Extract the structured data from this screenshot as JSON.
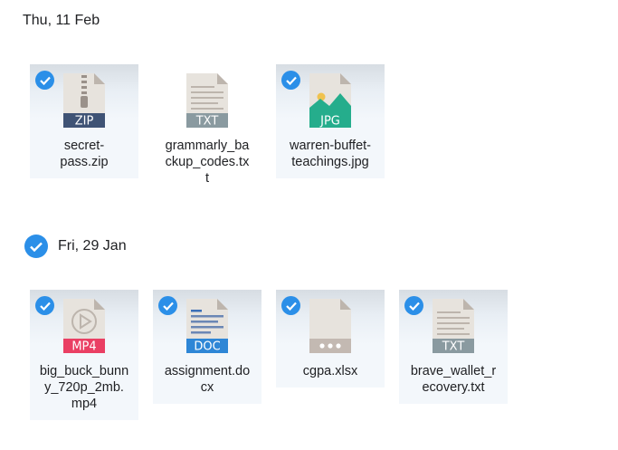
{
  "groups": [
    {
      "date": "Thu, 11 Feb",
      "group_selected": false,
      "files": [
        {
          "name": "secret-\npass.zip",
          "type": "ZIP",
          "selected": true,
          "icon": "zip-file-icon"
        },
        {
          "name": "grammarly_ba\nckup_codes.tx\nt",
          "type": "TXT",
          "selected": false,
          "icon": "txt-file-icon"
        },
        {
          "name": "warren-buffet-\nteachings.jpg",
          "type": "JPG",
          "selected": true,
          "icon": "image-file-icon"
        }
      ]
    },
    {
      "date": "Fri, 29 Jan",
      "group_selected": true,
      "files": [
        {
          "name": "big_buck_bunn\ny_720p_2mb.\nmp4",
          "type": "MP4",
          "selected": true,
          "icon": "video-file-icon"
        },
        {
          "name": "assignment.do\ncx",
          "type": "DOC",
          "selected": true,
          "icon": "doc-file-icon"
        },
        {
          "name": "cgpa.xlsx",
          "type": "",
          "selected": true,
          "icon": "generic-file-icon"
        },
        {
          "name": "brave_wallet_r\necovery.txt",
          "type": "TXT",
          "selected": true,
          "icon": "txt-file-icon"
        }
      ]
    }
  ],
  "colors": {
    "accent": "#2b8fe8",
    "zip_band": "#3f5375",
    "txt_band": "#8a9aa0",
    "jpg_band": "#25ad8c",
    "mp4_band": "#ea3f63",
    "doc_band": "#2e86d6",
    "generic_band": "#c3b9b2",
    "page": "#e7e3dd",
    "fold": "#bdb5ad"
  }
}
